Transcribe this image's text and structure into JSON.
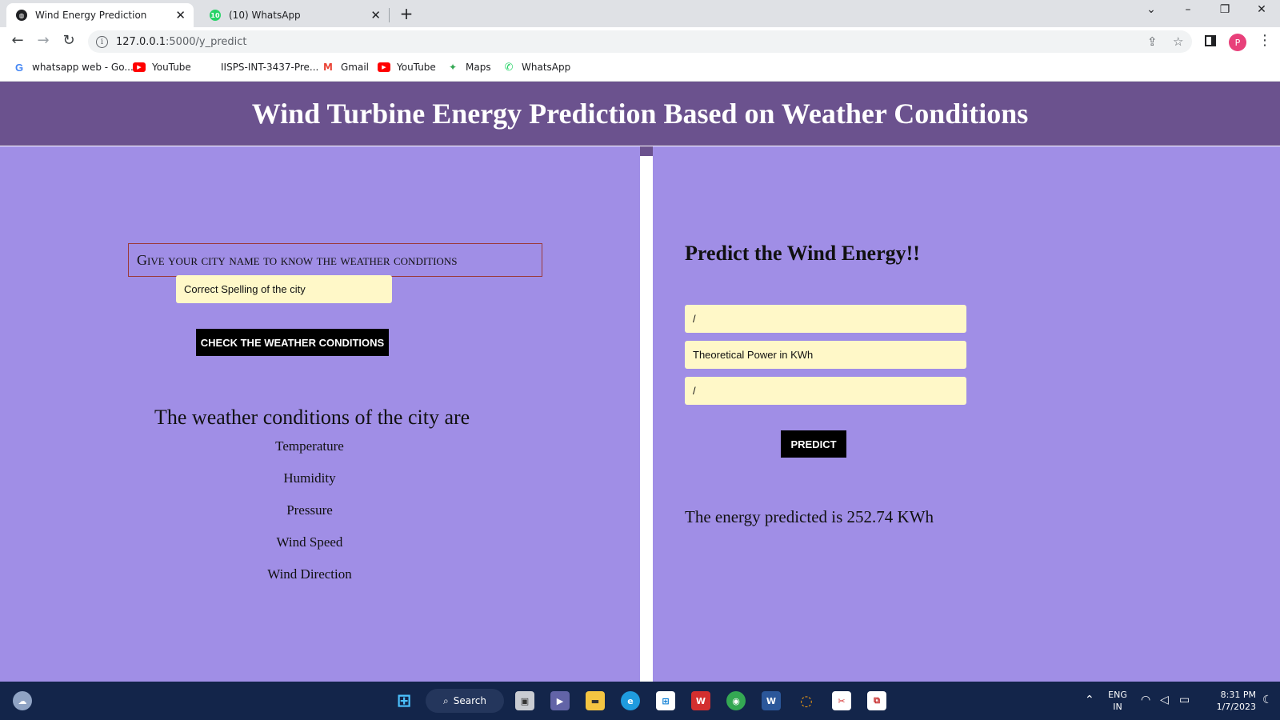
{
  "browser": {
    "tabs": [
      {
        "label": "Wind Energy Prediction",
        "active": true,
        "favicon": "globe-icon"
      },
      {
        "label": "(10) WhatsApp",
        "active": false,
        "favicon": "whatsapp-icon",
        "badge": "10"
      }
    ],
    "url_host": "127.0.0.1",
    "url_path": ":5000/y_predict",
    "profile_initial": "P",
    "bookmarks": [
      {
        "label": "whatsapp web - Go...",
        "icon": "google-icon"
      },
      {
        "label": "YouTube",
        "icon": "youtube-icon"
      },
      {
        "label": "IISPS-INT-3437-Pre...",
        "icon": "blank-icon"
      },
      {
        "label": "Gmail",
        "icon": "gmail-icon"
      },
      {
        "label": "YouTube",
        "icon": "youtube-icon"
      },
      {
        "label": "Maps",
        "icon": "maps-icon"
      },
      {
        "label": "WhatsApp",
        "icon": "whatsapp-icon"
      }
    ]
  },
  "page": {
    "title": "Wind Turbine Energy Prediction Based on Weather Conditions",
    "left": {
      "city_heading": "Give your city name to know the weather conditions",
      "city_input_placeholder": "Correct Spelling of the city",
      "check_button": "Check the Weather Conditions",
      "weather_heading": "The weather conditions of the city are",
      "weather_items": [
        "Temperature",
        "Humidity",
        "Pressure",
        "Wind Speed",
        "Wind Direction"
      ]
    },
    "right": {
      "heading": "Predict the Wind Energy!!",
      "fields": [
        {
          "placeholder": "/"
        },
        {
          "placeholder": "Theoretical Power in KWh"
        },
        {
          "placeholder": "/"
        }
      ],
      "predict_button": "Predict",
      "result": "The energy predicted is 252.74 KWh"
    }
  },
  "taskbar": {
    "search_label": "Search",
    "lang_top": "ENG",
    "lang_bottom": "IN",
    "time": "8:31 PM",
    "date": "1/7/2023"
  },
  "colors": {
    "header": "#6b528e",
    "panel": "#a08ee6",
    "input": "#fff8c8",
    "button": "#000000"
  }
}
